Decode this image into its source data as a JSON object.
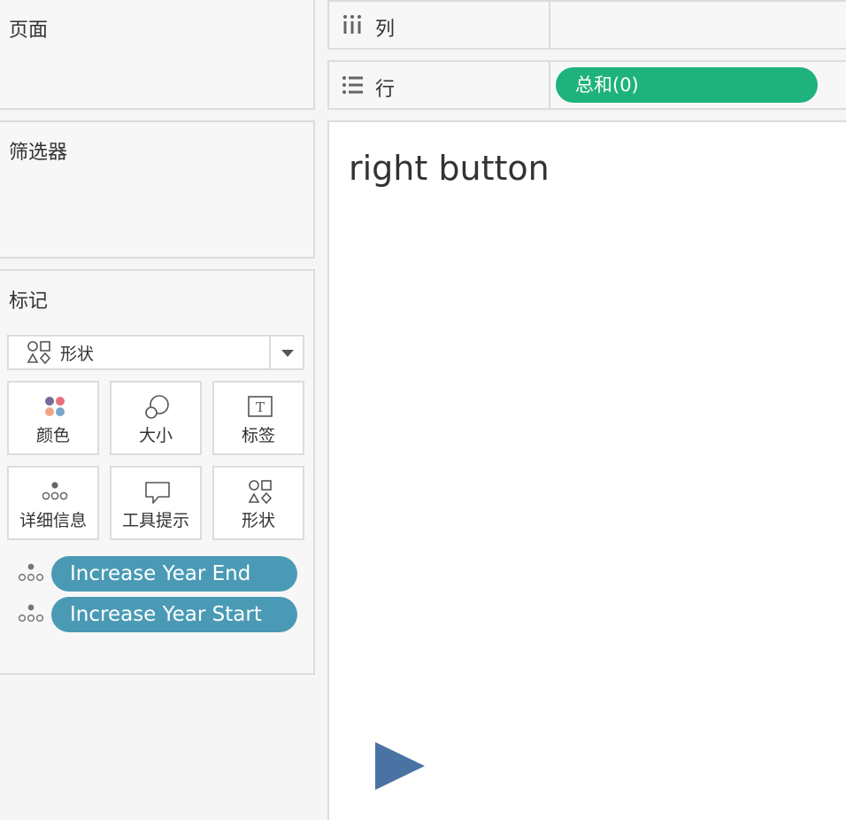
{
  "left_panel": {
    "pages_title": "页面",
    "filters_title": "筛选器",
    "marks": {
      "title": "标记",
      "mark_type": {
        "icon": "shapes-icon",
        "label": "形状"
      },
      "properties": [
        {
          "icon": "color-icon",
          "label": "颜色"
        },
        {
          "icon": "size-icon",
          "label": "大小"
        },
        {
          "icon": "label-icon",
          "label": "标签"
        },
        {
          "icon": "detail-icon",
          "label": "详细信息"
        },
        {
          "icon": "tooltip-icon",
          "label": "工具提示"
        },
        {
          "icon": "shapes-icon",
          "label": "形状"
        }
      ],
      "fields": [
        {
          "icon": "detail-icon",
          "label": "Increase Year End"
        },
        {
          "icon": "detail-icon",
          "label": "Increase Year Start"
        }
      ]
    }
  },
  "shelves": {
    "columns": {
      "icon": "columns-icon",
      "label": "列"
    },
    "rows": {
      "icon": "rows-icon",
      "label": "行",
      "pill": "总和(0)"
    }
  },
  "canvas": {
    "title": "right button",
    "shape": "play-triangle"
  },
  "colors": {
    "field_pill": "#4a9ab5",
    "measure_pill": "#1eb27c",
    "triangle": "#4a73a3"
  }
}
